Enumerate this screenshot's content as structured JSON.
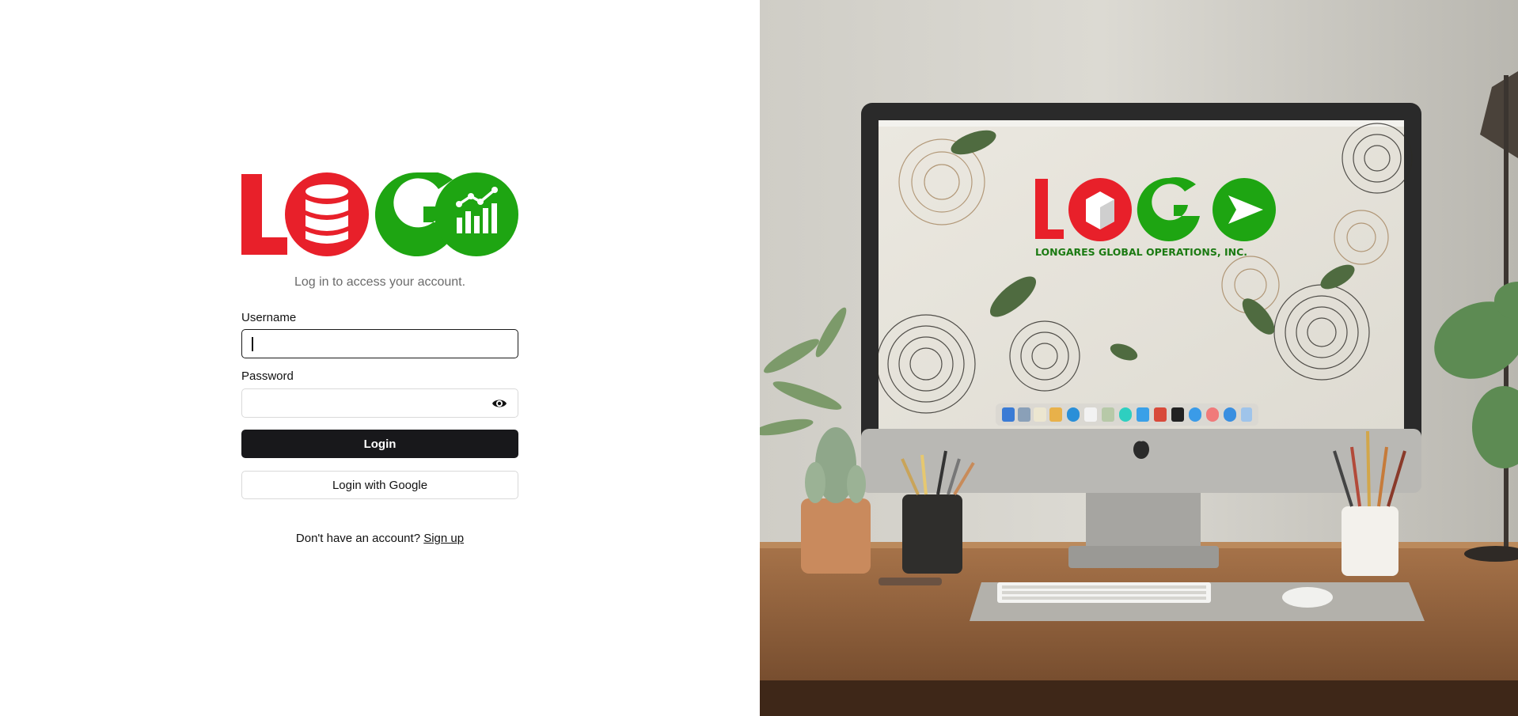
{
  "login": {
    "logo_alt": "LOGO",
    "subtitle": "Log in to access your account.",
    "username_label": "Username",
    "username_value": "",
    "password_label": "Password",
    "password_value": "",
    "login_button": "Login",
    "google_button": "Login with Google",
    "signup_prompt": "Don't have an account?",
    "signup_link": "Sign up"
  },
  "hero": {
    "screen_logo": "LOGO",
    "screen_tagline": "LONGARES GLOBAL OPERATIONS, INC."
  },
  "colors": {
    "brand_red": "#e8202a",
    "brand_green": "#1ea512",
    "button_dark": "#18181b"
  }
}
